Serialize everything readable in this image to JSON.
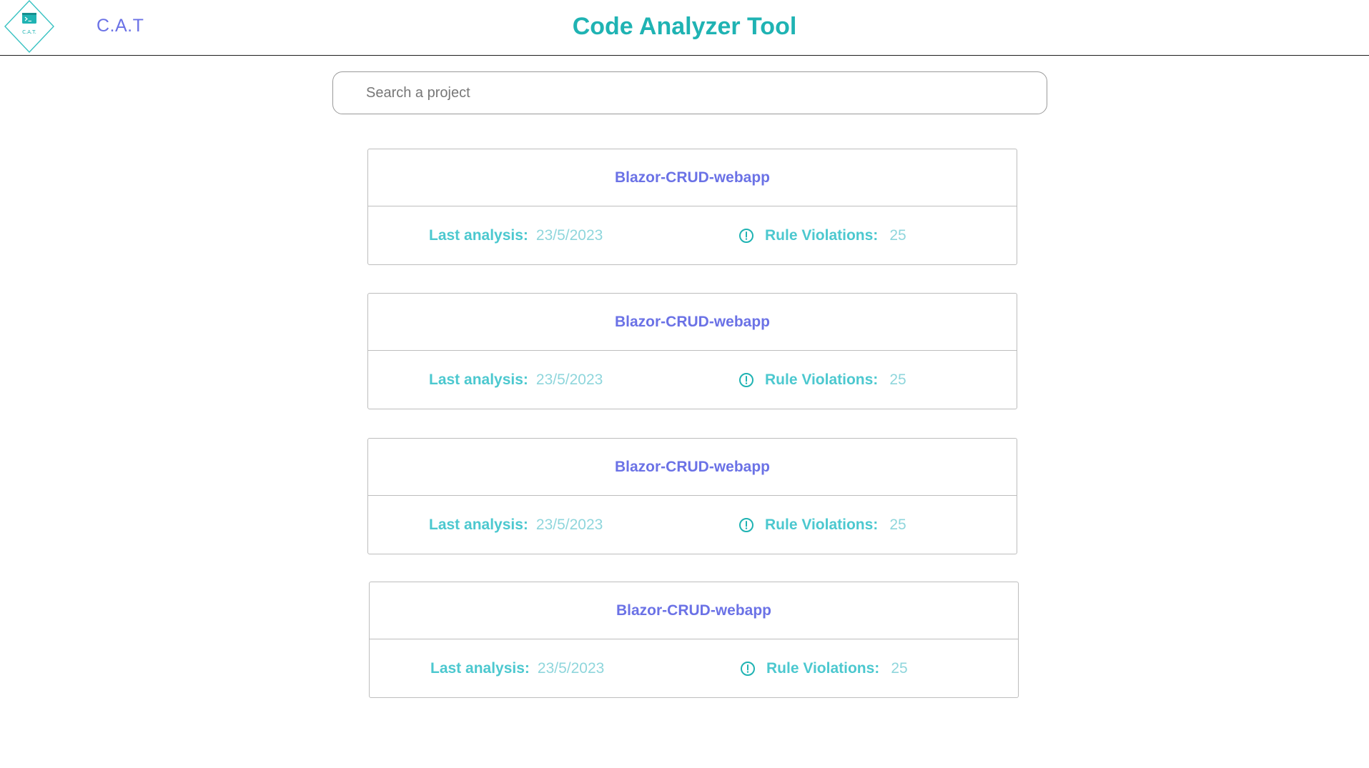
{
  "header": {
    "logo_text": "C.A.T.",
    "brand": "C.A.T",
    "title": "Code Analyzer Tool"
  },
  "search": {
    "placeholder": "Search a project",
    "value": ""
  },
  "projects": [
    {
      "name": "Blazor-CRUD-webapp",
      "last_analysis_label": "Last analysis:",
      "last_analysis": "23/5/2023",
      "violations_label": "Rule Violations:",
      "violations": "25"
    },
    {
      "name": "Blazor-CRUD-webapp",
      "last_analysis_label": "Last analysis:",
      "last_analysis": "23/5/2023",
      "violations_label": "Rule Violations:",
      "violations": "25"
    },
    {
      "name": "Blazor-CRUD-webapp",
      "last_analysis_label": "Last analysis:",
      "last_analysis": "23/5/2023",
      "violations_label": "Rule Violations:",
      "violations": "25"
    },
    {
      "name": "Blazor-CRUD-webapp",
      "last_analysis_label": "Last analysis:",
      "last_analysis": "23/5/2023",
      "violations_label": "Rule Violations:",
      "violations": "25"
    }
  ],
  "icons": {
    "logo": "terminal-logo-icon",
    "violation": "alert-circle-icon"
  },
  "colors": {
    "accent_teal": "#1fb3b3",
    "accent_purple": "#6b72e6",
    "meta_label": "#4cc8cf",
    "meta_value": "#8fd6dc"
  }
}
